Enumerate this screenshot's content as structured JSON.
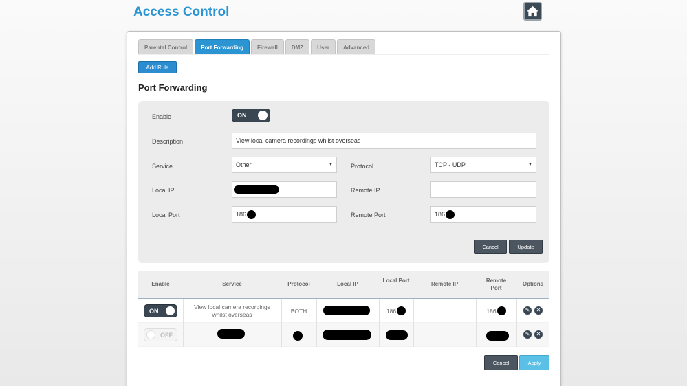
{
  "header": {
    "title": "Access Control",
    "home_icon": "home-icon"
  },
  "tabs": [
    {
      "label": "Parental Control",
      "active": false
    },
    {
      "label": "Port Forwarding",
      "active": true
    },
    {
      "label": "Firewall",
      "active": false
    },
    {
      "label": "DMZ",
      "active": false
    },
    {
      "label": "User",
      "active": false
    },
    {
      "label": "Advanced",
      "active": false
    }
  ],
  "add_rule_label": "Add Rule",
  "section_title": "Port Forwarding",
  "form": {
    "enable_label": "Enable",
    "enable_state": "ON",
    "description_label": "Description",
    "description_value": "View local camera recordings whilst overseas",
    "service_label": "Service",
    "service_value": "Other",
    "protocol_label": "Protocol",
    "protocol_value": "TCP - UDP",
    "local_ip_label": "Local IP",
    "remote_ip_label": "Remote IP",
    "local_port_label": "Local Port",
    "local_port_value": "186",
    "remote_port_label": "Remote Port",
    "remote_port_value": "186",
    "cancel_label": "Cancel",
    "update_label": "Update"
  },
  "table": {
    "headers": {
      "enable": "Enable",
      "service": "Service",
      "protocol": "Protocol",
      "local_ip": "Local IP",
      "local_port": "Local Port",
      "remote_ip": "Remote IP",
      "remote_port": "Remote Port",
      "options": "Options"
    },
    "rows": [
      {
        "enable": "ON",
        "service": "View local camera recordings whilst overseas",
        "protocol": "BOTH",
        "local_port": "186",
        "remote_port": "186"
      },
      {
        "enable": "OFF"
      }
    ]
  },
  "footer": {
    "cancel_label": "Cancel",
    "apply_label": "Apply"
  },
  "colors": {
    "accent": "#2b95d3",
    "dark": "#3a4752",
    "apply": "#5bc0e6"
  }
}
